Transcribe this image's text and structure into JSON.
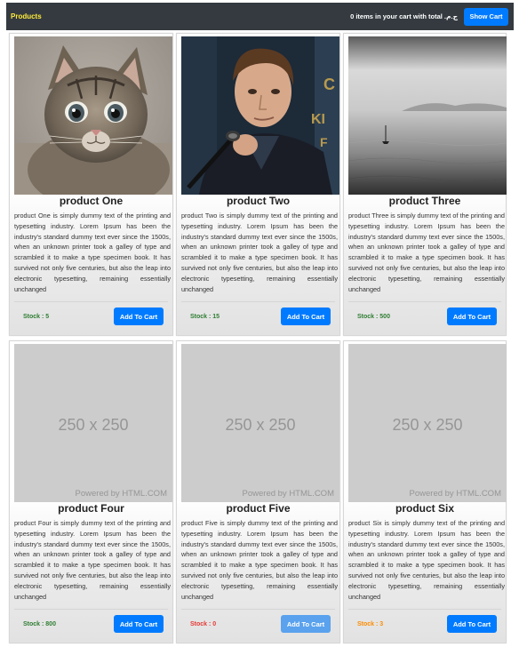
{
  "navbar": {
    "brand": "Products",
    "cart_summary": "0 items in your cart with total ج.م.‏",
    "show_cart_label": "Show Cart"
  },
  "placeholder": {
    "size_text": "250 x 250",
    "powered_text": "Powered by HTML.COM"
  },
  "products": [
    {
      "title": "product One",
      "description": "product One is simply dummy text of the printing and typesetting industry. Lorem Ipsum has been the industry's standard dummy text ever since the 1500s, when an unknown printer took a galley of type and scrambled it to make a type specimen book. It has survived not only five centuries, but also the leap into electronic typesetting, remaining essentially unchanged",
      "stock": "Stock : 5",
      "button": "Add To Cart"
    },
    {
      "title": "product Two",
      "description": "product Two is simply dummy text of the printing and typesetting industry. Lorem Ipsum has been the industry's standard dummy text ever since the 1500s, when an unknown printer took a galley of type and scrambled it to make a type specimen book. It has survived not only five centuries, but also the leap into electronic typesetting, remaining essentially unchanged",
      "stock": "Stock : 15",
      "button": "Add To Cart"
    },
    {
      "title": "product Three",
      "description": "product Three is simply dummy text of the printing and typesetting industry. Lorem Ipsum has been the industry's standard dummy text ever since the 1500s, when an unknown printer took a galley of type and scrambled it to make a type specimen book. It has survived not only five centuries, but also the leap into electronic typesetting, remaining essentially unchanged",
      "stock": "Stock : 500",
      "button": "Add To Cart"
    },
    {
      "title": "product Four",
      "description": "product Four is simply dummy text of the printing and typesetting industry. Lorem Ipsum has been the industry's standard dummy text ever since the 1500s, when an unknown printer took a galley of type and scrambled it to make a type specimen book. It has survived not only five centuries, but also the leap into electronic typesetting, remaining essentially unchanged",
      "stock": "Stock : 800",
      "button": "Add To Cart"
    },
    {
      "title": "product Five",
      "description": "product Five is simply dummy text of the printing and typesetting industry. Lorem Ipsum has been the industry's standard dummy text ever since the 1500s, when an unknown printer took a galley of type and scrambled it to make a type specimen book. It has survived not only five centuries, but also the leap into electronic typesetting, remaining essentially unchanged",
      "stock": "Stock : 0",
      "button": "Add To Cart"
    },
    {
      "title": "product Six",
      "description": "product Six is simply dummy text of the printing and typesetting industry. Lorem Ipsum has been the industry's standard dummy text ever since the 1500s, when an unknown printer took a galley of type and scrambled it to make a type specimen book. It has survived not only five centuries, but also the leap into electronic typesetting, remaining essentially unchanged",
      "stock": "Stock : 3",
      "button": "Add To Cart"
    }
  ]
}
